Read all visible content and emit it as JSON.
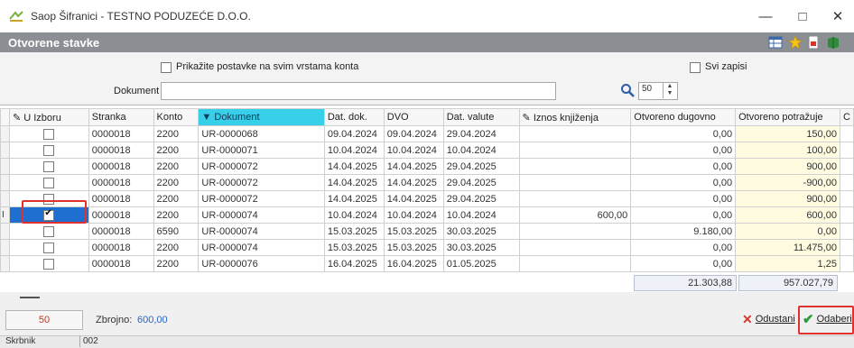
{
  "window": {
    "title": "Saop Šifranici - TESTNO PODUZEĆE D.O.O.",
    "min": "—",
    "max": "□",
    "close": "✕"
  },
  "section": {
    "title": "Otvorene stavke",
    "icons": [
      "grid-settings-icon",
      "favorite-star-icon",
      "pdf-export-icon",
      "help-book-icon"
    ]
  },
  "filters": {
    "show_all_label": "Prikažite postavke na svim vrstama konta",
    "all_records_label": "Svi zapisi",
    "document_label": "Dokument",
    "document_value": "",
    "page_size": "50"
  },
  "table": {
    "columns": [
      "U Izboru",
      "Stranka",
      "Konto",
      "Dokument",
      "Dat. dok.",
      "DVO",
      "Dat. valute",
      "Iznos knjiženja",
      "Otvoreno dugovno",
      "Otvoreno potražuje",
      "C"
    ],
    "rows": [
      {
        "checked": false,
        "stranka": "0000018",
        "konto": "2200",
        "dokument": "UR-0000068",
        "dat_dok": "09.04.2024",
        "dvo": "09.04.2024",
        "dat_valute": "29.04.2024",
        "iznos": "",
        "dugovno": "0,00",
        "potrazuje": "150,00"
      },
      {
        "checked": false,
        "stranka": "0000018",
        "konto": "2200",
        "dokument": "UR-0000071",
        "dat_dok": "10.04.2024",
        "dvo": "10.04.2024",
        "dat_valute": "10.04.2024",
        "iznos": "",
        "dugovno": "0,00",
        "potrazuje": "100,00"
      },
      {
        "checked": false,
        "stranka": "0000018",
        "konto": "2200",
        "dokument": "UR-0000072",
        "dat_dok": "14.04.2025",
        "dvo": "14.04.2025",
        "dat_valute": "29.04.2025",
        "iznos": "",
        "dugovno": "0,00",
        "potrazuje": "900,00"
      },
      {
        "checked": false,
        "stranka": "0000018",
        "konto": "2200",
        "dokument": "UR-0000072",
        "dat_dok": "14.04.2025",
        "dvo": "14.04.2025",
        "dat_valute": "29.04.2025",
        "iznos": "",
        "dugovno": "0,00",
        "potrazuje": "-900,00"
      },
      {
        "checked": false,
        "stranka": "0000018",
        "konto": "2200",
        "dokument": "UR-0000072",
        "dat_dok": "14.04.2025",
        "dvo": "14.04.2025",
        "dat_valute": "29.04.2025",
        "iznos": "",
        "dugovno": "0,00",
        "potrazuje": "900,00"
      },
      {
        "checked": true,
        "selected": true,
        "stranka": "0000018",
        "konto": "2200",
        "dokument": "UR-0000074",
        "dat_dok": "10.04.2024",
        "dvo": "10.04.2024",
        "dat_valute": "10.04.2024",
        "iznos": "600,00",
        "dugovno": "0,00",
        "potrazuje": "600,00"
      },
      {
        "checked": false,
        "stranka": "0000018",
        "konto": "6590",
        "dokument": "UR-0000074",
        "dat_dok": "15.03.2025",
        "dvo": "15.03.2025",
        "dat_valute": "30.03.2025",
        "iznos": "",
        "dugovno": "9.180,00",
        "potrazuje": "0,00"
      },
      {
        "checked": false,
        "stranka": "0000018",
        "konto": "2200",
        "dokument": "UR-0000074",
        "dat_dok": "15.03.2025",
        "dvo": "15.03.2025",
        "dat_valute": "30.03.2025",
        "iznos": "",
        "dugovno": "0,00",
        "potrazuje": "11.475,00"
      },
      {
        "checked": false,
        "stranka": "0000018",
        "konto": "2200",
        "dokument": "UR-0000076",
        "dat_dok": "16.04.2025",
        "dvo": "16.04.2025",
        "dat_valute": "01.05.2025",
        "iznos": "",
        "dugovno": "0,00",
        "potrazuje": "1,25"
      }
    ],
    "total_dugovno": "21.303,88",
    "total_potrazuje": "957.027,79"
  },
  "footer": {
    "count": "50",
    "sum_label": "Zbrojno:",
    "sum_value": "600,00",
    "cancel_label": "Odustani",
    "choose_label": "Odaberi"
  },
  "status": {
    "user": "Skrbnik",
    "code": "002"
  },
  "colors": {
    "accent_sort": "#37d0e8",
    "selected_cell": "#1f6fd1",
    "highlight_border": "#e0312f",
    "potrazuje_bg": "#fffbe0"
  }
}
